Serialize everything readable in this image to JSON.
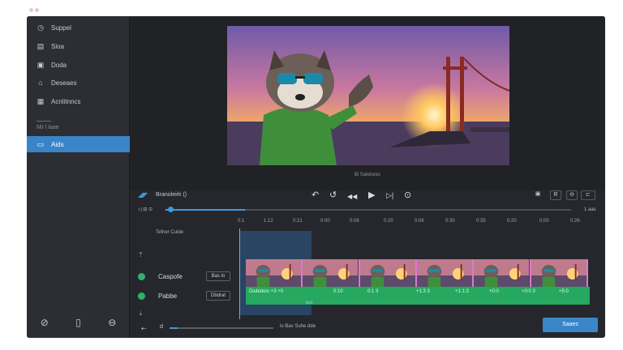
{
  "sidebar": {
    "items": [
      {
        "label": "Suppel",
        "icon": "clock-icon",
        "glyph": "◷"
      },
      {
        "label": "Sioa",
        "icon": "layers-icon",
        "glyph": "▤"
      },
      {
        "label": "Doda",
        "icon": "image-icon",
        "glyph": "▣"
      },
      {
        "label": "Deseaes",
        "icon": "monitor-icon",
        "glyph": "⌂"
      },
      {
        "label": "Acnlitnncs",
        "icon": "document-icon",
        "glyph": "▦"
      }
    ],
    "section_label": "Nlr l laae",
    "active_item": {
      "label": "Aids",
      "icon": "folder-icon",
      "glyph": "▭"
    },
    "bottom_icons": [
      {
        "name": "search-person-icon",
        "glyph": "⊘"
      },
      {
        "name": "trash-icon",
        "glyph": "▯"
      },
      {
        "name": "share-icon",
        "glyph": "⊖"
      }
    ]
  },
  "preview": {
    "caption": "Bi Satelores"
  },
  "controls": {
    "project_label": "Branoleirk ()",
    "buttons": [
      {
        "name": "undo-icon",
        "glyph": "↶"
      },
      {
        "name": "redo-icon",
        "glyph": "↺"
      },
      {
        "name": "rewind-icon",
        "glyph": "◀◀"
      },
      {
        "name": "play-icon",
        "glyph": "▶"
      },
      {
        "name": "forward-icon",
        "glyph": "▷|"
      },
      {
        "name": "loop-icon",
        "glyph": "⊙"
      }
    ],
    "right_buttons": [
      "▣",
      "R",
      "⊖",
      "⊏"
    ],
    "volume_icon": "◁ ⊟ ⊙",
    "time_end": "1 aas"
  },
  "ruler": {
    "ticks": [
      "0:1",
      "1:12",
      "0:21",
      "0:00",
      "0:06",
      "0:20",
      "0:06",
      "0:30",
      "0:35",
      "0:20",
      "0:00",
      "0:26"
    ]
  },
  "tracks": {
    "header": "Tefner Cuide",
    "rows": [
      {
        "name": "Caspofe",
        "button": "Bas lo"
      },
      {
        "name": "Pabbe",
        "button": "Dbdrat"
      }
    ],
    "audio_labels": [
      "Diubidoio +3 +0",
      "0:10",
      "0:1 3",
      "+1:3 3",
      "+1:1:3",
      "+0:0",
      "+0:0 3",
      "+5:0"
    ],
    "hint": "bcd"
  },
  "footer": {
    "left_icon": "⇠",
    "zoom_label": "d",
    "zoom_text": "lo Bas Suhe dde",
    "save_label": "Saaes"
  },
  "colors": {
    "accent": "#3a86c8",
    "track_green": "#26a861",
    "selection": "#2e5f92"
  }
}
